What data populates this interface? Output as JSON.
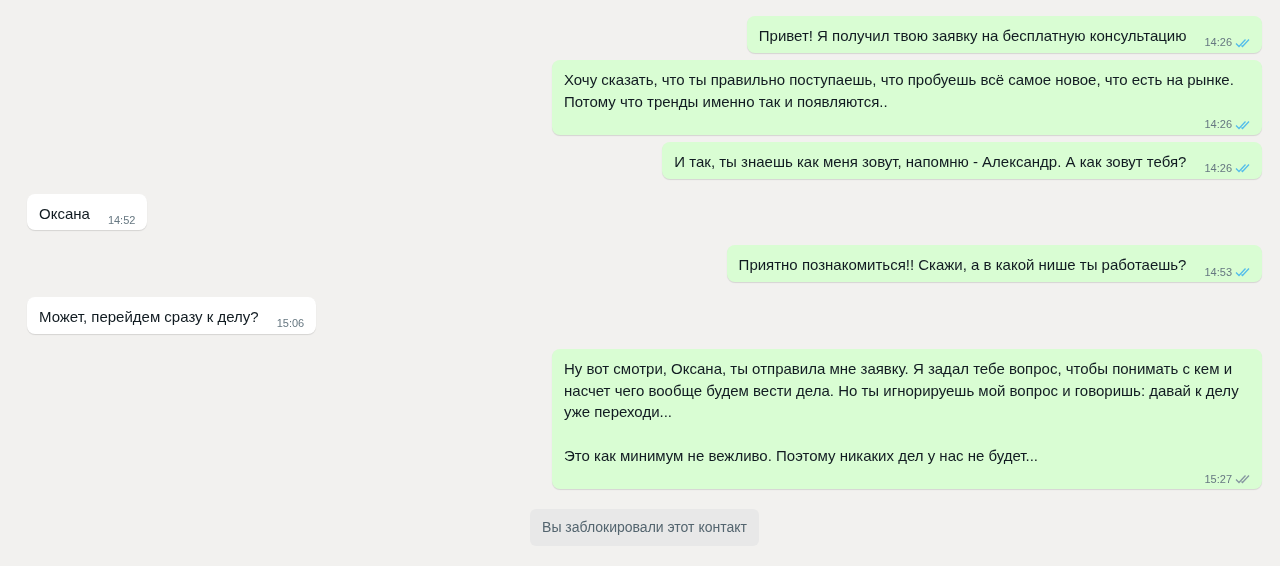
{
  "messages": [
    {
      "kind": "outgoing",
      "text": "Привет! Я получил твою заявку на бесплатную консультацию",
      "time": "14:26",
      "read": true
    },
    {
      "kind": "outgoing",
      "text": "Хочу сказать, что ты правильно поступаешь, что пробуешь всё самое новое, что есть на рынке. Потому что тренды именно так и появляются..",
      "time": "14:26",
      "read": true
    },
    {
      "kind": "outgoing",
      "text": "И так, ты знаешь как меня зовут, напомню - Александр. А как зовут тебя?",
      "time": "14:26",
      "read": true
    },
    {
      "kind": "incoming",
      "text": "Оксана",
      "time": "14:52"
    },
    {
      "kind": "outgoing",
      "text": "Приятно познакомиться!! Скажи, а в какой нише ты работаешь?",
      "time": "14:53",
      "read": true
    },
    {
      "kind": "incoming",
      "text": "Может, перейдем сразу к делу?",
      "time": "15:06"
    },
    {
      "kind": "outgoing",
      "text": "Ну вот смотри, Оксана, ты отправила мне заявку. Я задал тебе вопрос, чтобы понимать с кем и насчет чего вообще будем вести дела. Но ты игнорируешь мой вопрос и говоришь: давай к делу уже переходи...\n\nЭто как минимум не вежливо. Поэтому никаких дел у нас не будет...",
      "time": "15:27",
      "read": false
    },
    {
      "kind": "system",
      "text": "Вы заблокировали этот контакт"
    }
  ]
}
